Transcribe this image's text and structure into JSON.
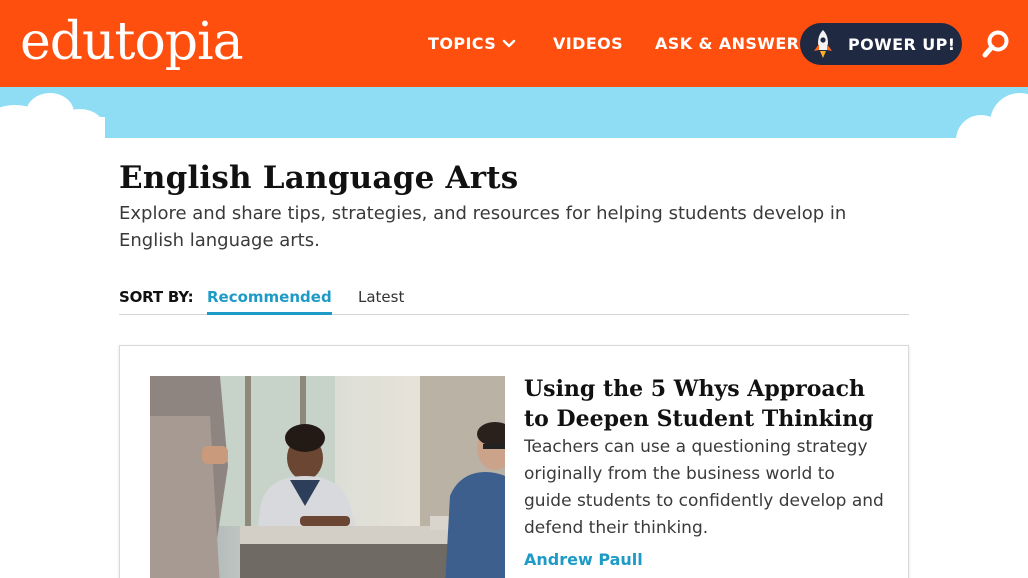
{
  "header": {
    "logo_text": "edutopia",
    "nav": [
      {
        "label": "TOPICS"
      },
      {
        "label": "VIDEOS"
      },
      {
        "label": "ASK & ANSWER"
      }
    ],
    "power_up_label": "POWER UP!",
    "icons": [
      "chevron-down-icon",
      "rocket-icon",
      "search-icon"
    ],
    "colors": {
      "brand": "#ff4f0f",
      "power_up_bg": "#1f2942",
      "sky": "#8fdcf5"
    }
  },
  "main": {
    "title": "English Language Arts",
    "description": "Explore and share tips, strategies, and resources for helping students develop in English language arts.",
    "sort": {
      "label": "SORT BY:",
      "options": [
        {
          "label": "Recommended",
          "active": true
        },
        {
          "label": "Latest",
          "active": false
        }
      ],
      "accent": "#1d9bc6"
    },
    "articles": [
      {
        "title": "Using the 5 Whys Approach to Deepen Student Thinking",
        "summary": "Teachers can use a questioning strategy originally from the business world to guide students to confidently develop and defend their thinking.",
        "author": "Andrew Paull"
      }
    ]
  }
}
